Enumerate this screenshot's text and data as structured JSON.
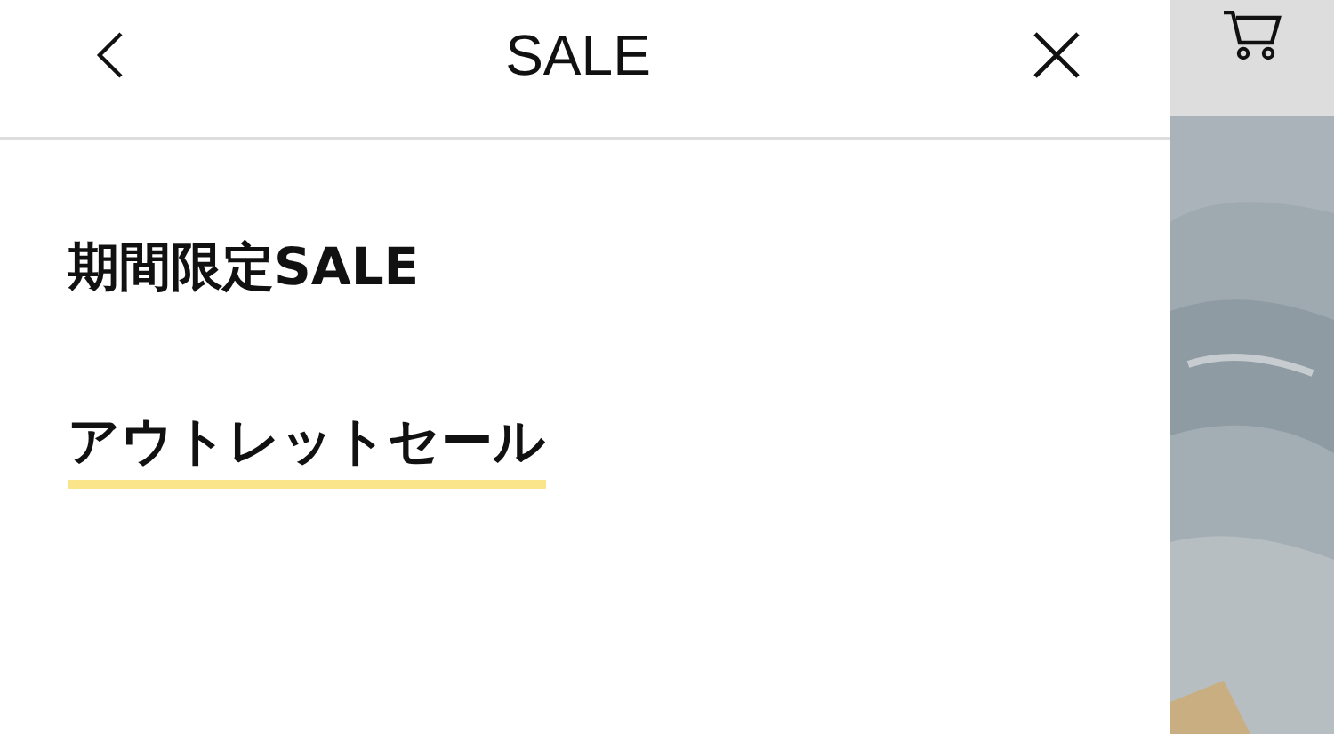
{
  "header": {
    "title": "SALE"
  },
  "menu_items": [
    {
      "label": "期間限定SALE",
      "selected": false
    },
    {
      "label": "アウトレットセール",
      "selected": true
    }
  ]
}
